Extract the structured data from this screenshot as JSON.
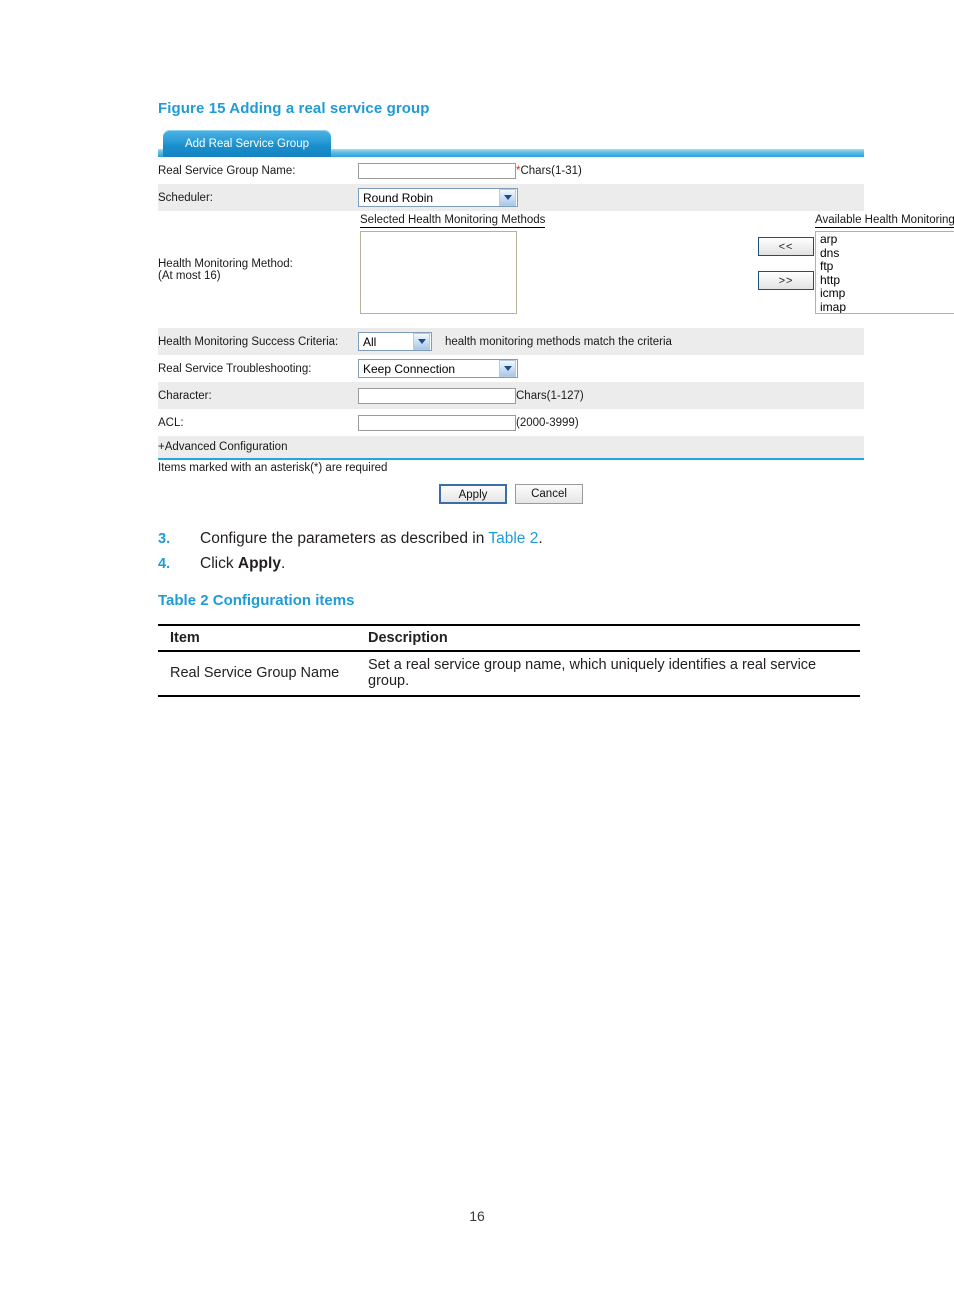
{
  "figure": {
    "caption": "Figure 15 Adding a real service group"
  },
  "webui": {
    "tab_label": "Add Real Service Group",
    "rows": {
      "group_name": {
        "label": "Real Service Group Name:",
        "value": "",
        "required_mark": "*",
        "hint": "Chars(1-31)"
      },
      "scheduler": {
        "label": "Scheduler:",
        "value": "Round Robin"
      },
      "health_method": {
        "label_line1": "Health Monitoring Method:",
        "label_line2": "(At most 16)",
        "selected_label": "Selected Health Monitoring Methods",
        "available_label": "Available Health Monitoring Methods",
        "selected_items": [],
        "available_items": [
          "arp",
          "dns",
          "ftp",
          "http",
          "icmp",
          "imap"
        ],
        "move_left_label": "<<",
        "move_right_label": ">>"
      },
      "success_criteria": {
        "label": "Health Monitoring Success Criteria:",
        "value": "All",
        "hint": "health monitoring methods match the criteria"
      },
      "troubleshooting": {
        "label": "Real Service Troubleshooting:",
        "value": "Keep Connection"
      },
      "character": {
        "label": "Character:",
        "value": "",
        "hint": "Chars(1-127)"
      },
      "acl": {
        "label": "ACL:",
        "value": "",
        "hint": "(2000-3999)"
      },
      "advanced": {
        "label": "+Advanced Configuration"
      }
    },
    "required_note": "Items marked with an asterisk(*) are required",
    "buttons": {
      "apply": "Apply",
      "cancel": "Cancel"
    }
  },
  "steps": [
    {
      "num": "3.",
      "text_before": "Configure the parameters as described in ",
      "link": "Table 2",
      "text_after": "."
    },
    {
      "num": "4.",
      "text_before": "Click ",
      "bold": "Apply",
      "text_after": "."
    }
  ],
  "table": {
    "caption": "Table 2 Configuration items",
    "headers": [
      "Item",
      "Description"
    ],
    "rows": [
      {
        "item": "Real Service Group Name",
        "description": "Set a real service group name, which uniquely identifies a real service group."
      }
    ]
  },
  "page_number": "16",
  "colors": {
    "accent_blue": "#1f9cd7",
    "tab_blue": "#2d9fd9",
    "row_alt": "#ececec",
    "required_star": "#e0262a"
  }
}
